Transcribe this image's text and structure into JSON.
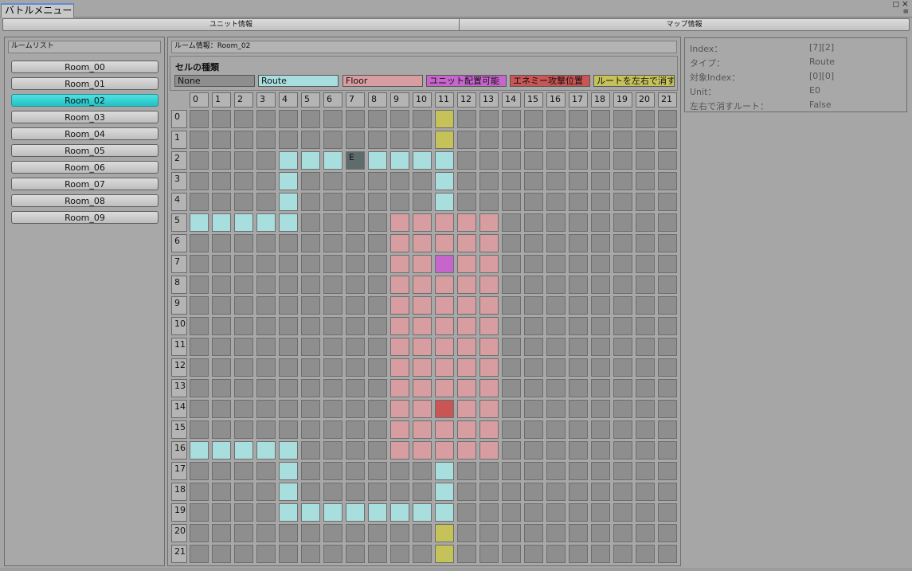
{
  "window": {
    "tab_title": "バトルメニュー",
    "menu_icon": "≡",
    "maximize_icon": "□",
    "close_icon": "×"
  },
  "toolbar": {
    "unit_info": "ユニット情報",
    "map_info": "マップ情報"
  },
  "room_list": {
    "header": "ルームリスト",
    "rooms": [
      "Room_00",
      "Room_01",
      "Room_02",
      "Room_03",
      "Room_04",
      "Room_05",
      "Room_06",
      "Room_07",
      "Room_08",
      "Room_09"
    ],
    "selected_index": 2
  },
  "room_info": {
    "header": "ルーム情報：Room_02",
    "cell_types_title": "セルの種類",
    "cell_types": [
      {
        "key": "none",
        "label": "None",
        "color": "#8e8e8e"
      },
      {
        "key": "route",
        "label": "Route",
        "color": "#a9dede"
      },
      {
        "key": "floor",
        "label": "Floor",
        "color": "#d89da0"
      },
      {
        "key": "unit",
        "label": "ユニット配置可能",
        "color": "#c666cc"
      },
      {
        "key": "enemy",
        "label": "エネミー攻撃位置",
        "color": "#c95555"
      },
      {
        "key": "lr",
        "label": "ルートを左右で消す",
        "color": "#c6c25a"
      }
    ],
    "columns": [
      "0",
      "1",
      "2",
      "3",
      "4",
      "5",
      "6",
      "7",
      "8",
      "9",
      "10",
      "11",
      "12",
      "13",
      "14",
      "15",
      "16",
      "17",
      "18",
      "19",
      "20",
      "21"
    ],
    "rows": [
      "0",
      "1",
      "2",
      "3",
      "4",
      "5",
      "6",
      "7",
      "8",
      "9",
      "10",
      "11",
      "12",
      "13",
      "14",
      "15",
      "16",
      "17",
      "18",
      "19",
      "20",
      "21"
    ],
    "colors": {
      "none": "#8e8e8e",
      "route": "#a9dede",
      "floor": "#d89da0",
      "unit": "#c666cc",
      "enemy": "#c95555",
      "lr": "#c6c25a",
      "selected": "#5f6c6c"
    },
    "grid": [
      "00000000000Y0000000000",
      "00000000000Y0000000000",
      "0000RRRSRRRR0000000000",
      "0000R000000R0000000000",
      "0000R000000R0000000000",
      "RRRRR0000FFFFF00000000",
      "000000000FFFFF00000000",
      "000000000FFUFF00000000",
      "000000000FFFFF00000000",
      "000000000FFFFF00000000",
      "000000000FFFFF00000000",
      "000000000FFFFF00000000",
      "000000000FFFFF00000000",
      "000000000FFFFF00000000",
      "000000000FFEFF00000000",
      "000000000FFFFF00000000",
      "RRRRR0000FFFFF00000000",
      "0000R000000R0000000000",
      "0000R000000R0000000000",
      "0000RRRRRRRR0000000000",
      "00000000000Y0000000000",
      "00000000000Y0000000000"
    ],
    "selected_cell": {
      "col": 7,
      "row": 2,
      "label": "E"
    }
  },
  "cell_info": [
    {
      "label": "Index：",
      "value": "[7][2]"
    },
    {
      "label": "タイプ：",
      "value": "Route"
    },
    {
      "label": "対象Index：",
      "value": "[0][0]"
    },
    {
      "label": "Unit：",
      "value": "E0"
    },
    {
      "label": "左右で消すルート：",
      "value": "False"
    }
  ]
}
